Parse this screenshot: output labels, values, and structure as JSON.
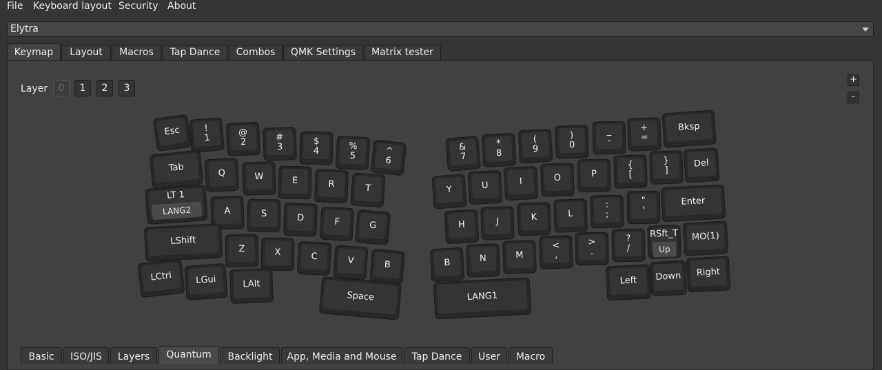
{
  "menu": [
    "File",
    "Keyboard layout",
    "Security",
    "About"
  ],
  "device": {
    "selected": "Elytra"
  },
  "tabs": [
    {
      "label": "Keymap",
      "active": true
    },
    {
      "label": "Layout",
      "active": false
    },
    {
      "label": "Macros",
      "active": false
    },
    {
      "label": "Tap Dance",
      "active": false
    },
    {
      "label": "Combos",
      "active": false
    },
    {
      "label": "QMK Settings",
      "active": false
    },
    {
      "label": "Matrix tester",
      "active": false
    }
  ],
  "layer": {
    "label": "Layer",
    "buttons": [
      {
        "label": "0",
        "active": true
      },
      {
        "label": "1",
        "active": false
      },
      {
        "label": "2",
        "active": false
      },
      {
        "label": "3",
        "active": false
      }
    ]
  },
  "zoom": {
    "in_label": "+",
    "out_label": "-"
  },
  "keys": [
    {
      "lines": [
        "Esc"
      ]
    },
    {
      "lines": [
        "!",
        "1"
      ]
    },
    {
      "lines": [
        "@",
        "2"
      ]
    },
    {
      "lines": [
        "#",
        "3"
      ]
    },
    {
      "lines": [
        "$",
        "4"
      ]
    },
    {
      "lines": [
        "%",
        "5"
      ]
    },
    {
      "lines": [
        "^",
        "6"
      ]
    },
    {
      "lines": [
        "Tab"
      ]
    },
    {
      "lines": [
        "Q"
      ]
    },
    {
      "lines": [
        "W"
      ]
    },
    {
      "lines": [
        "E"
      ]
    },
    {
      "lines": [
        "R"
      ]
    },
    {
      "lines": [
        "T"
      ]
    },
    {
      "lines": [
        "LT 1"
      ],
      "sub": "LANG2"
    },
    {
      "lines": [
        "A"
      ]
    },
    {
      "lines": [
        "S"
      ]
    },
    {
      "lines": [
        "D"
      ]
    },
    {
      "lines": [
        "F"
      ]
    },
    {
      "lines": [
        "G"
      ]
    },
    {
      "lines": [
        "LShift"
      ]
    },
    {
      "lines": [
        "Z"
      ]
    },
    {
      "lines": [
        "X"
      ]
    },
    {
      "lines": [
        "C"
      ]
    },
    {
      "lines": [
        "V"
      ]
    },
    {
      "lines": [
        "B"
      ]
    },
    {
      "lines": [
        "LCtrl"
      ]
    },
    {
      "lines": [
        "LGui"
      ]
    },
    {
      "lines": [
        "LAlt"
      ]
    },
    {
      "lines": [
        "Space"
      ]
    },
    {
      "lines": [
        "&",
        "7"
      ]
    },
    {
      "lines": [
        "*",
        "8"
      ]
    },
    {
      "lines": [
        "(",
        "9"
      ]
    },
    {
      "lines": [
        ")",
        "0"
      ]
    },
    {
      "lines": [
        "_",
        "-"
      ]
    },
    {
      "lines": [
        "+",
        "="
      ]
    },
    {
      "lines": [
        "Bksp"
      ]
    },
    {
      "lines": [
        "Y"
      ]
    },
    {
      "lines": [
        "U"
      ]
    },
    {
      "lines": [
        "I"
      ]
    },
    {
      "lines": [
        "O"
      ]
    },
    {
      "lines": [
        "P"
      ]
    },
    {
      "lines": [
        "{",
        "["
      ]
    },
    {
      "lines": [
        "}",
        "]"
      ]
    },
    {
      "lines": [
        "Del"
      ]
    },
    {
      "lines": [
        "H"
      ]
    },
    {
      "lines": [
        "J"
      ]
    },
    {
      "lines": [
        "K"
      ]
    },
    {
      "lines": [
        "L"
      ]
    },
    {
      "lines": [
        ":",
        ";"
      ]
    },
    {
      "lines": [
        "\"",
        "'"
      ]
    },
    {
      "lines": [
        "Enter"
      ]
    },
    {
      "lines": [
        "B"
      ]
    },
    {
      "lines": [
        "N"
      ]
    },
    {
      "lines": [
        "M"
      ]
    },
    {
      "lines": [
        "<",
        ","
      ]
    },
    {
      "lines": [
        ">",
        "."
      ]
    },
    {
      "lines": [
        "?",
        "/"
      ]
    },
    {
      "lines": [
        "RSft_T"
      ],
      "sub": "Up"
    },
    {
      "lines": [
        "MO(1)"
      ]
    },
    {
      "lines": [
        "LANG1"
      ]
    },
    {
      "lines": [
        "Left"
      ]
    },
    {
      "lines": [
        "Down"
      ]
    },
    {
      "lines": [
        "Right"
      ]
    }
  ],
  "bottom_tabs": [
    {
      "label": "Basic",
      "active": false
    },
    {
      "label": "ISO/JIS",
      "active": false
    },
    {
      "label": "Layers",
      "active": false
    },
    {
      "label": "Quantum",
      "active": true
    },
    {
      "label": "Backlight",
      "active": false
    },
    {
      "label": "App, Media and Mouse",
      "active": false
    },
    {
      "label": "Tap Dance",
      "active": false
    },
    {
      "label": "User",
      "active": false
    },
    {
      "label": "Macro",
      "active": false
    }
  ]
}
